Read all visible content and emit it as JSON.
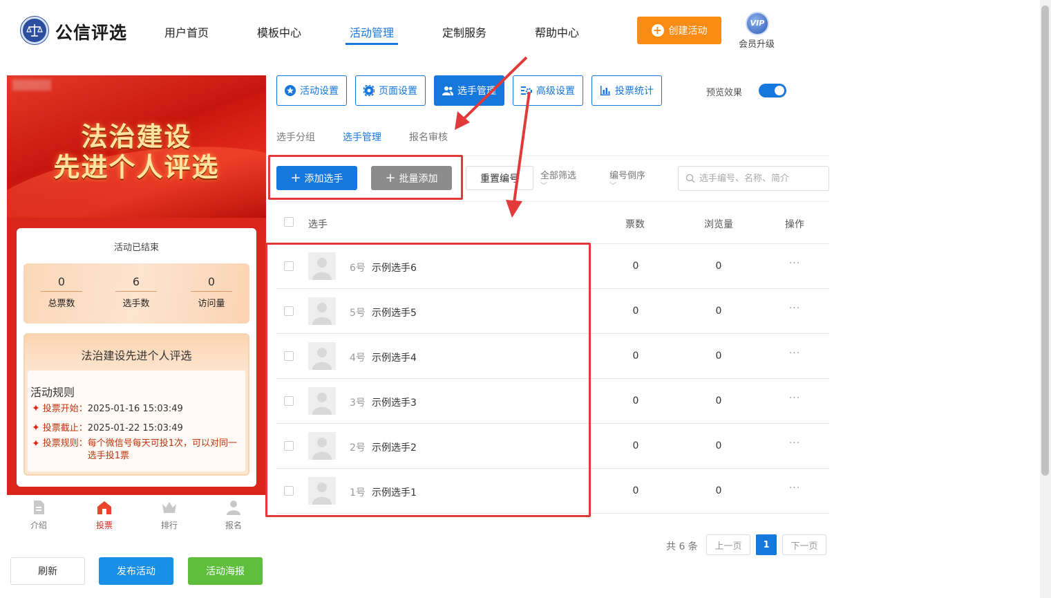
{
  "header": {
    "brand": "公信评选",
    "nav": [
      {
        "label": "用户首页",
        "active": false
      },
      {
        "label": "模板中心",
        "active": false
      },
      {
        "label": "活动管理",
        "active": true
      },
      {
        "label": "定制服务",
        "active": false
      },
      {
        "label": "帮助中心",
        "active": false
      }
    ],
    "create_label": "创建活动",
    "vip_badge": "VIP",
    "vip_label": "会员升级",
    "accent_color": "#1677dd",
    "create_color": "#fa8c16"
  },
  "preview": {
    "banner_line1": "法治建设",
    "banner_line2": "先进个人评选",
    "status": "活动已结束",
    "stats": [
      {
        "value": "0",
        "label": "总票数"
      },
      {
        "value": "6",
        "label": "选手数"
      },
      {
        "value": "0",
        "label": "访问量"
      }
    ],
    "activity_name": "法治建设先进个人评选",
    "rules_title": "活动规则",
    "rules": [
      {
        "label": "投票开始：",
        "value": "2025-01-16 15:03:49"
      },
      {
        "label": "投票截止：",
        "value": "2025-01-22 15:03:49"
      },
      {
        "label": "投票规则：",
        "value": "每个微信号每天可投1次，可以对同一选手投1票"
      }
    ],
    "tabs": [
      {
        "label": "介绍",
        "icon": "document-icon"
      },
      {
        "label": "投票",
        "icon": "home-icon",
        "active": true
      },
      {
        "label": "排行",
        "icon": "crown-icon"
      },
      {
        "label": "报名",
        "icon": "person-icon"
      }
    ],
    "theme_color": "#d9261c"
  },
  "panel_buttons": {
    "refresh": "刷新",
    "publish": "发布活动",
    "poster": "活动海报"
  },
  "toolbar": {
    "buttons": [
      {
        "label": "活动设置",
        "icon": "star-icon"
      },
      {
        "label": "页面设置",
        "icon": "gear-icon"
      },
      {
        "label": "选手管理",
        "icon": "users-icon",
        "active": true
      },
      {
        "label": "高级设置",
        "icon": "settings-list-icon"
      },
      {
        "label": "投票统计",
        "icon": "bar-chart-icon"
      }
    ],
    "preview_label": "预览效果",
    "preview_on": true
  },
  "subtabs": [
    {
      "label": "选手分组"
    },
    {
      "label": "选手管理",
      "active": true
    },
    {
      "label": "报名审核"
    }
  ],
  "actions": {
    "add": "添加选手",
    "batch": "批量添加",
    "reset": "重置编号",
    "filter_all": "全部筛选",
    "sort": "编号倒序",
    "search_placeholder": "选手编号、名称、简介"
  },
  "table": {
    "headers": {
      "player": "选手",
      "votes": "票数",
      "views": "浏览量",
      "actions": "操作"
    },
    "rows": [
      {
        "num": "6号",
        "name": "示例选手6",
        "votes": "0",
        "views": "0"
      },
      {
        "num": "5号",
        "name": "示例选手5",
        "votes": "0",
        "views": "0"
      },
      {
        "num": "4号",
        "name": "示例选手4",
        "votes": "0",
        "views": "0"
      },
      {
        "num": "3号",
        "name": "示例选手3",
        "votes": "0",
        "views": "0"
      },
      {
        "num": "2号",
        "name": "示例选手2",
        "votes": "0",
        "views": "0"
      },
      {
        "num": "1号",
        "name": "示例选手1",
        "votes": "0",
        "views": "0"
      }
    ],
    "more_glyph": "···"
  },
  "pagination": {
    "total": "共 6 条",
    "prev": "上一页",
    "current": "1",
    "next": "下一页"
  },
  "annotation_color": "#e23a3a"
}
